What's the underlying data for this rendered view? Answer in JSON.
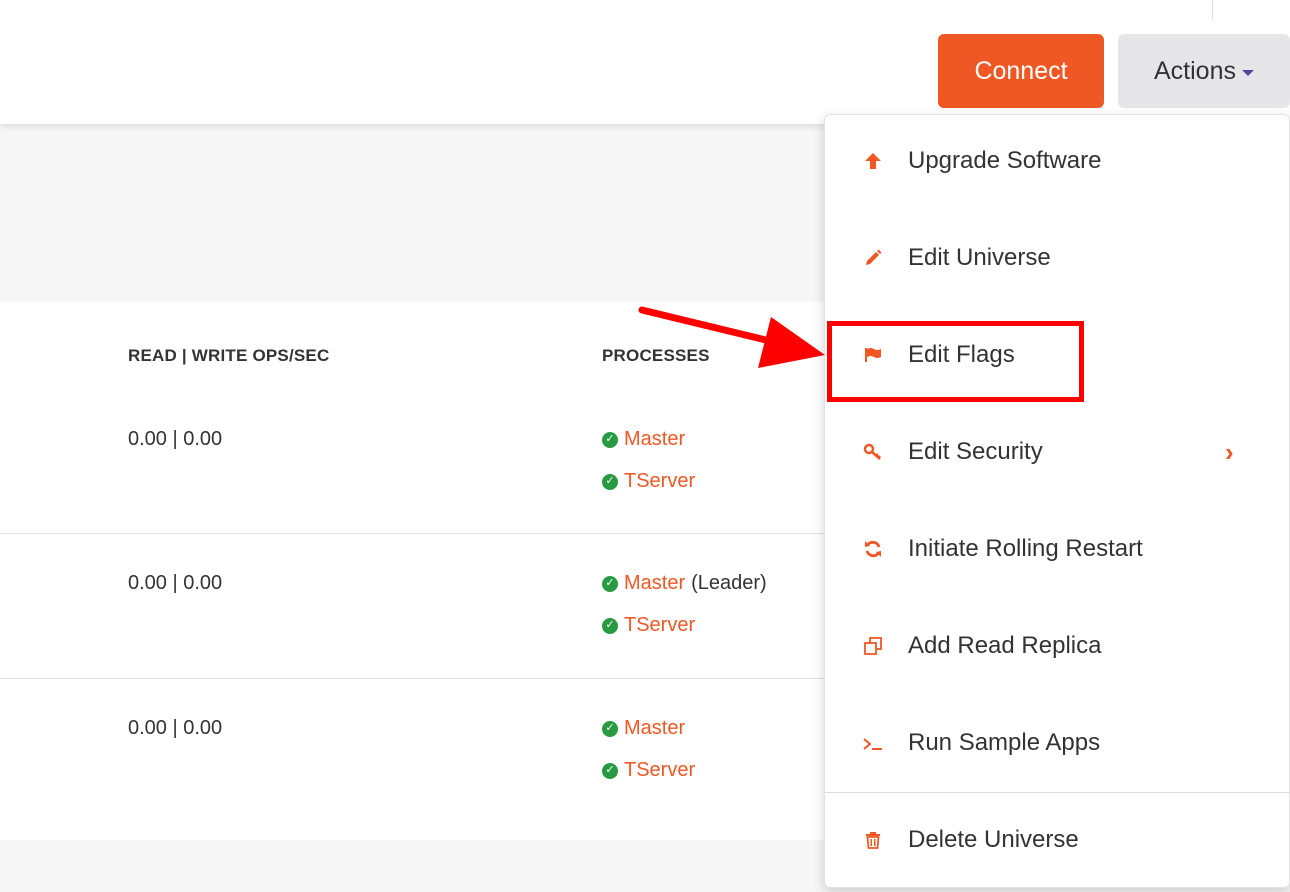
{
  "header": {
    "connect_label": "Connect",
    "actions_label": "Actions"
  },
  "table": {
    "columns": [
      "READ | WRITE OPS/SEC",
      "PROCESSES"
    ],
    "rows": [
      {
        "ops": "0.00 | 0.00",
        "master": "Master",
        "master_note": "",
        "tserver": "TServer"
      },
      {
        "ops": "0.00 | 0.00",
        "master": "Master",
        "master_note": "(Leader)",
        "tserver": "TServer"
      },
      {
        "ops": "0.00 | 0.00",
        "master": "Master",
        "master_note": "",
        "tserver": "TServer"
      }
    ]
  },
  "actions_menu": {
    "items": [
      {
        "label": "Upgrade Software",
        "icon": "arrow-up-icon"
      },
      {
        "label": "Edit Universe",
        "icon": "pencil-icon"
      },
      {
        "label": "Edit Flags",
        "icon": "flag-icon"
      },
      {
        "label": "Edit Security",
        "icon": "key-icon"
      },
      {
        "label": "Initiate Rolling Restart",
        "icon": "refresh-icon"
      },
      {
        "label": "Add Read Replica",
        "icon": "copy-icon"
      },
      {
        "label": "Run Sample Apps",
        "icon": "terminal-icon"
      },
      {
        "label": "Delete Universe",
        "icon": "trash-icon"
      }
    ]
  },
  "colors": {
    "accent": "#ef5824",
    "success": "#289b42",
    "annotation": "#ff0000"
  }
}
